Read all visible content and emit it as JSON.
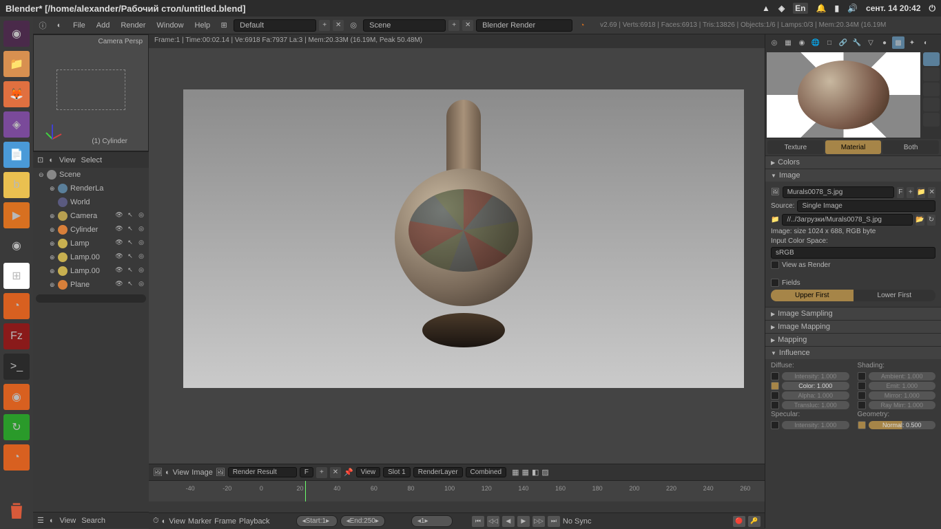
{
  "sysbar": {
    "title": "Blender* [/home/alexander/Рабочий стол/untitled.blend]",
    "lang": "En",
    "date": "сент. 14 20:42"
  },
  "info_header": {
    "menus": [
      "File",
      "Add",
      "Render",
      "Window",
      "Help"
    ],
    "layout": "Default",
    "scene": "Scene",
    "engine": "Blender Render",
    "version": "v2.69 | Verts:6918 | Faces:6913 | Tris:13826 | Objects:1/6 | Lamps:0/3 | Mem:20.34M (16.19M"
  },
  "camera_preview": {
    "title": "Camera Persp",
    "obj": "(1) Cylinder"
  },
  "outliner": {
    "menus": [
      "View",
      "Select"
    ],
    "scene": "Scene",
    "items": [
      {
        "name": "RenderLa",
        "icon": "#5a7f9a"
      },
      {
        "name": "World",
        "icon": "#5a5a7f"
      },
      {
        "name": "Camera",
        "icon": "#b8a050",
        "toggles": true
      },
      {
        "name": "Cylinder",
        "icon": "#d87f3a",
        "toggles": true
      },
      {
        "name": "Lamp",
        "icon": "#c8b050",
        "toggles": true
      },
      {
        "name": "Lamp.00",
        "icon": "#c8b050",
        "toggles": true
      },
      {
        "name": "Lamp.00",
        "icon": "#c8b050",
        "toggles": true
      },
      {
        "name": "Plane",
        "icon": "#d87f3a",
        "toggles": true
      }
    ],
    "footer": [
      "View",
      "Search"
    ]
  },
  "viewport": {
    "stats": "Frame:1 | Time:00:02.14 | Ve:6918 Fa:7937 La:3 | Mem:20.33M (16.19M, Peak 50.48M)",
    "footer": {
      "view": "View",
      "image": "Image",
      "render_result": "Render Result",
      "f": "F",
      "view2": "View",
      "slot": "Slot 1",
      "renderlayer": "RenderLayer",
      "combined": "Combined"
    }
  },
  "timeline": {
    "ticks": [
      "-40",
      "-20",
      "0",
      "20",
      "40",
      "60",
      "80",
      "100",
      "120",
      "140",
      "160",
      "180",
      "200",
      "220",
      "240",
      "260"
    ],
    "menus": [
      "View",
      "Marker",
      "Frame",
      "Playback"
    ],
    "start_label": "Start:",
    "start": "1",
    "end_label": "End:",
    "end": "250",
    "current": "1",
    "sync": "No Sync"
  },
  "props": {
    "tabs": [
      "Texture",
      "Material",
      "Both"
    ],
    "colors": "Colors",
    "image": "Image",
    "image_file": "Murals0078_S.jpg",
    "f_label": "F",
    "source_label": "Source:",
    "source": "Single Image",
    "path": "//../Загрузки/Murals0078_S.jpg",
    "image_info": "Image: size 1024 x 688, RGB byte",
    "colorspace_label": "Input Color Space:",
    "colorspace": "sRGB",
    "view_render": "View as Render",
    "fields": "Fields",
    "upper_first": "Upper First",
    "lower_first": "Lower First",
    "image_sampling": "Image Sampling",
    "image_mapping": "Image Mapping",
    "mapping": "Mapping",
    "influence": "Influence",
    "diffuse": "Diffuse:",
    "shading": "Shading:",
    "specular": "Specular:",
    "geometry": "Geometry:",
    "intensity": "Intensity: 1.000",
    "color": "Color: 1.000",
    "alpha": "Alpha: 1.000",
    "transluc": "Transluc: 1.000",
    "ambient": "Ambient: 1.000",
    "emit": "Emit: 1.000",
    "mirror": "Mirror: 1.000",
    "raymirr": "Ray Mirr: 1.000",
    "normal": "Normal: 0.500"
  }
}
